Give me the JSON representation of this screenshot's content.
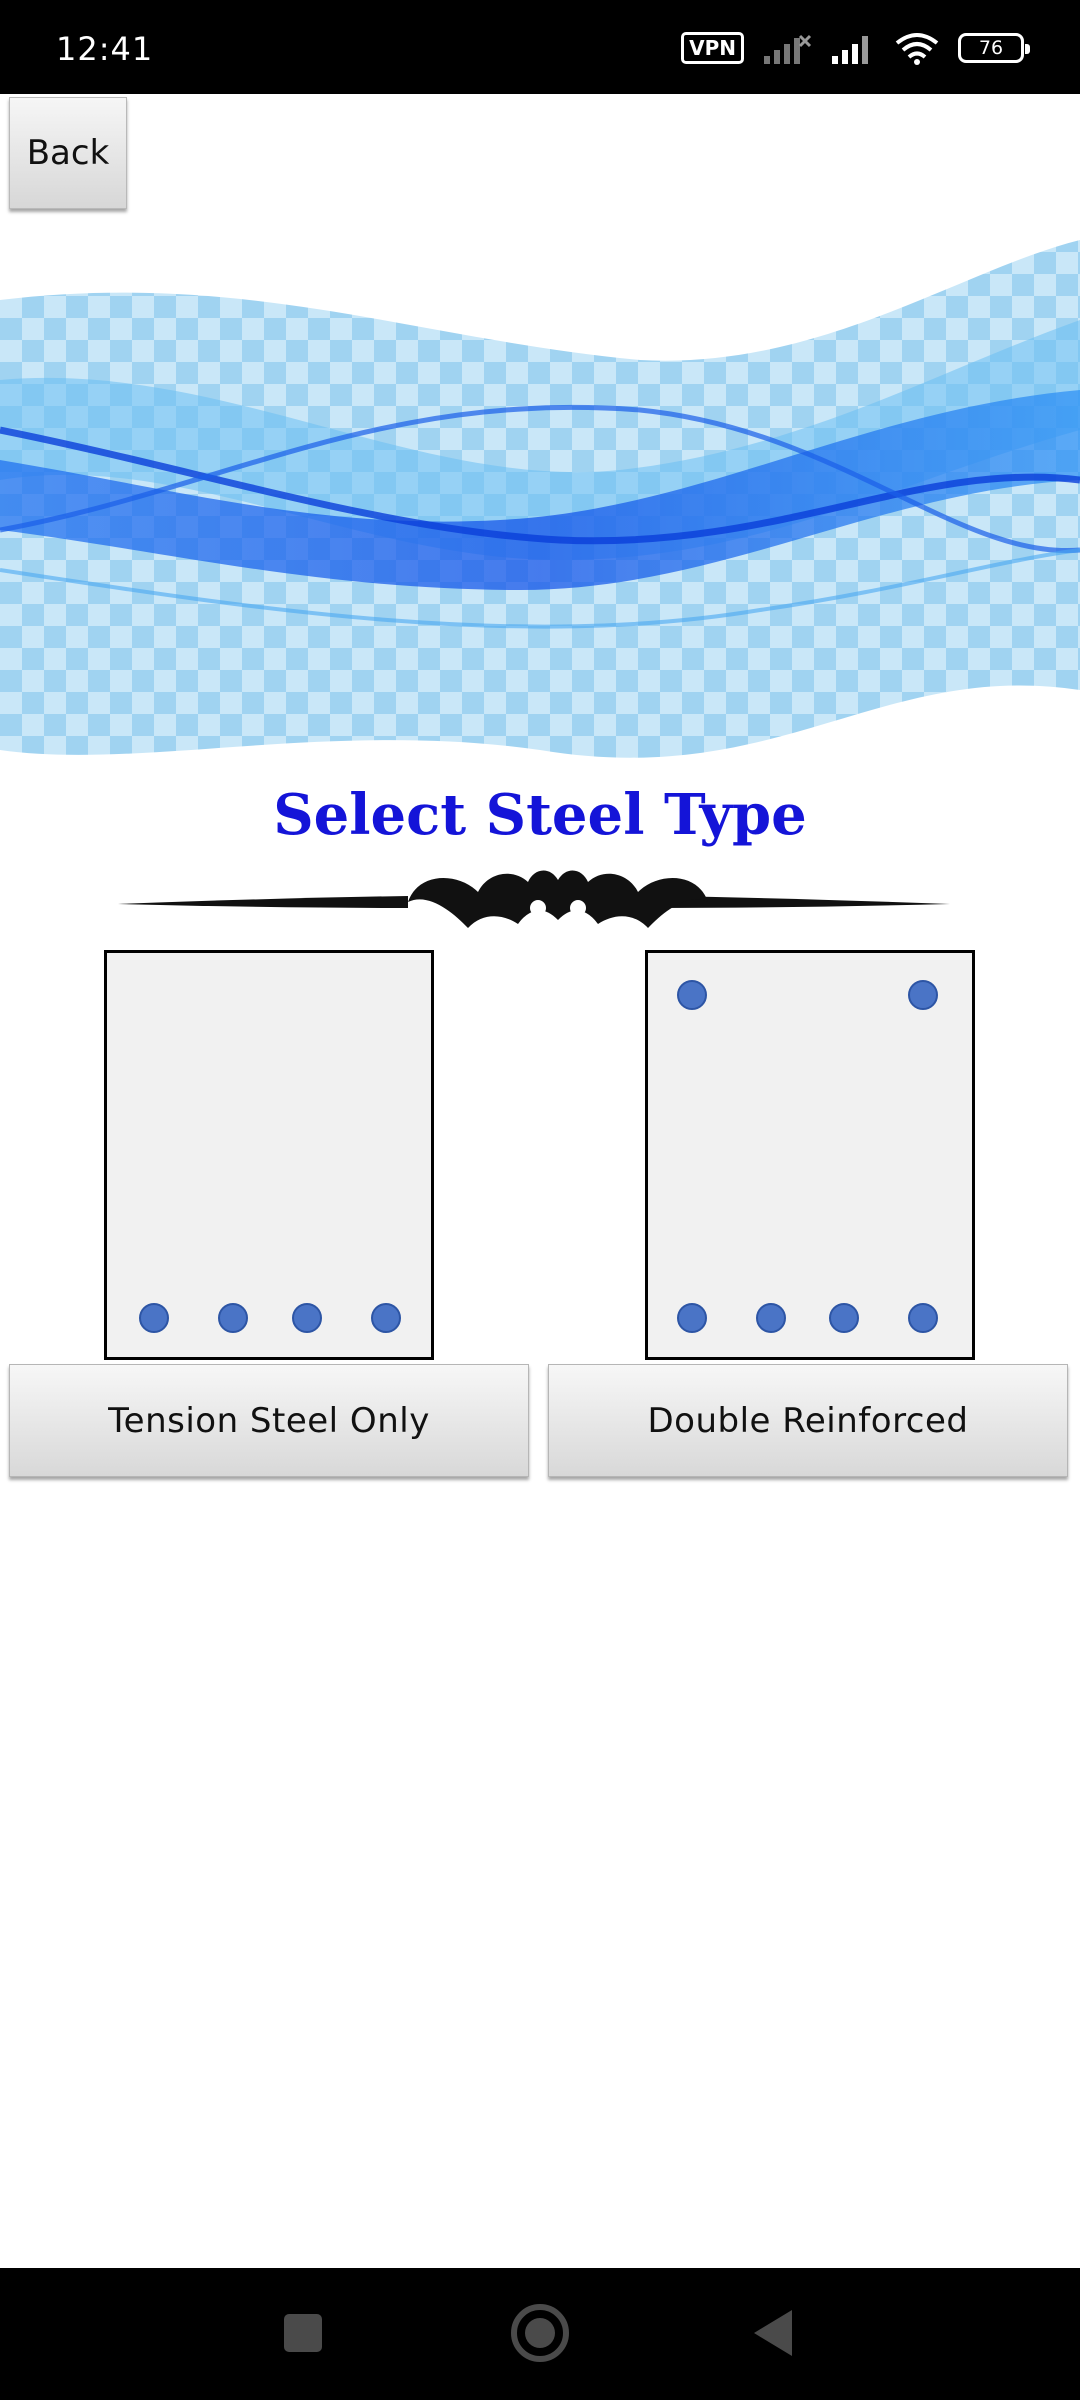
{
  "status_bar": {
    "time": "12:41",
    "vpn_label": "VPN",
    "battery_level": "76",
    "icons": [
      "vpn-icon",
      "signal-off-icon",
      "signal-icon",
      "wifi-icon",
      "battery-icon"
    ]
  },
  "toolbar": {
    "back_label": "Back"
  },
  "page": {
    "title": "Select Steel Type",
    "accent_color": "#1414d8"
  },
  "options": [
    {
      "label": "Tension Steel Only",
      "top_bars": 0,
      "bottom_bars": 4
    },
    {
      "label": "Double Reinforced",
      "top_bars": 2,
      "bottom_bars": 4
    }
  ],
  "nav_bar": {
    "icons": [
      "recent-apps-icon",
      "home-icon",
      "back-triangle-icon"
    ]
  }
}
